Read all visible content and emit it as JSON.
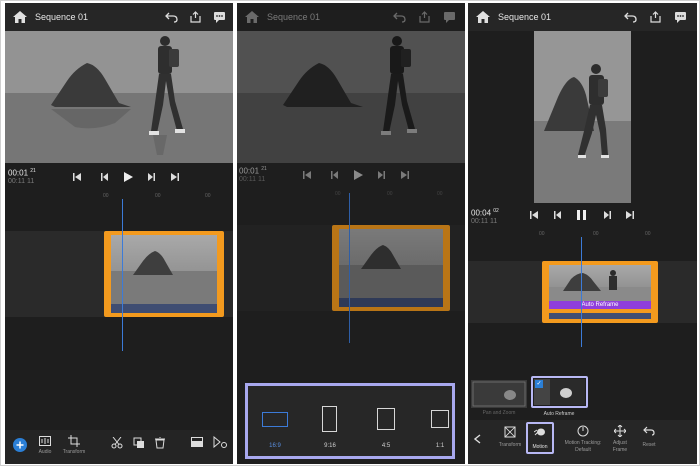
{
  "panel1": {
    "title": "Sequence 01",
    "time_main": "00:01",
    "time_main_frames": "21",
    "time_total": "00:11",
    "time_total_frames": "11",
    "bottom": {
      "audio_label": "Audio",
      "transform_label": "Transform"
    }
  },
  "panel2": {
    "title": "Sequence 01",
    "time_main": "00:01",
    "time_main_frames": "21",
    "time_total": "00:11",
    "time_total_frames": "11",
    "aspect_ratios": [
      {
        "label": "16:9",
        "selected": true
      },
      {
        "label": "9:16",
        "selected": false
      },
      {
        "label": "4:5",
        "selected": false
      },
      {
        "label": "1:1",
        "selected": false
      }
    ]
  },
  "panel3": {
    "title": "Sequence 01",
    "time_main": "00:04",
    "time_main_frames": "02",
    "time_total": "00:11",
    "time_total_frames": "11",
    "clip_badge": "Auto Reframe",
    "option_pan_label": "Pan and Zoom",
    "option_reframe_label": "Auto Reframe",
    "tools": {
      "transform": "Transform",
      "motion": "Motion",
      "motion_tracking": "Motion Tracking:",
      "motion_tracking_value": "Default",
      "adjust_frame": "Adjust",
      "adjust_frame_sub": "Frame",
      "reset": "Reset"
    }
  },
  "colors": {
    "panel_bg": "#1e1e1e",
    "clip_orange": "#f39a1e",
    "playhead_blue": "#3c7bd8",
    "accent_purple": "#8f3edb",
    "highlight_outline": "#a8a8ee",
    "add_button_blue": "#2b7fd6"
  }
}
